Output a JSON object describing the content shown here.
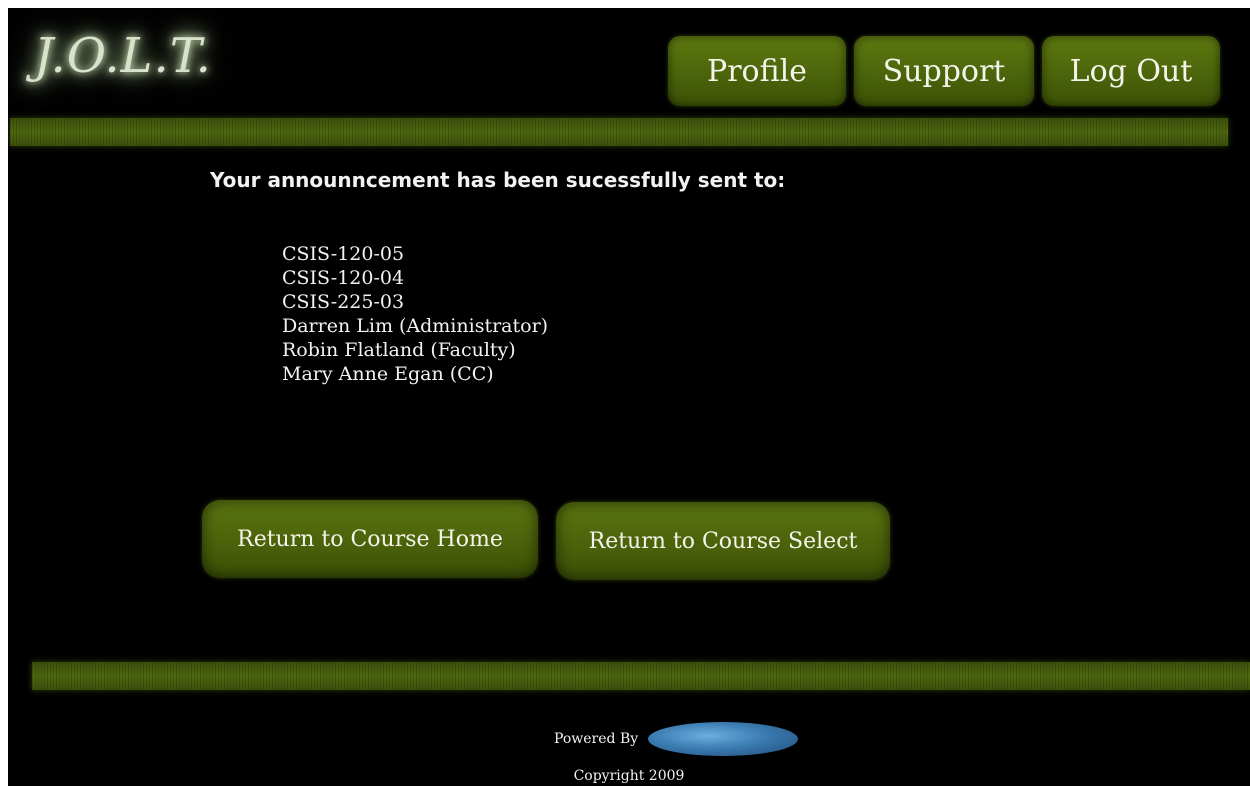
{
  "header": {
    "logo_text": "J.O.L.T.",
    "nav": {
      "profile": "Profile",
      "support": "Support",
      "logout": "Log Out"
    }
  },
  "main": {
    "headline": "Your announncement has been sucessfully sent to:",
    "recipients": [
      "CSIS-120-05",
      "CSIS-120-04",
      "CSIS-225-03",
      "Darren Lim (Administrator)",
      "Robin Flatland (Faculty)",
      "Mary Anne Egan (CC)"
    ],
    "buttons": {
      "course_home": "Return to Course Home",
      "course_select": "Return to Course Select"
    }
  },
  "footer": {
    "powered_by": "Powered By",
    "copyright": "Copyright 2009"
  },
  "colors": {
    "background": "#000000",
    "button_green": "#4a620a",
    "bar_green": "#4f6810",
    "text": "#f2f2f2"
  }
}
